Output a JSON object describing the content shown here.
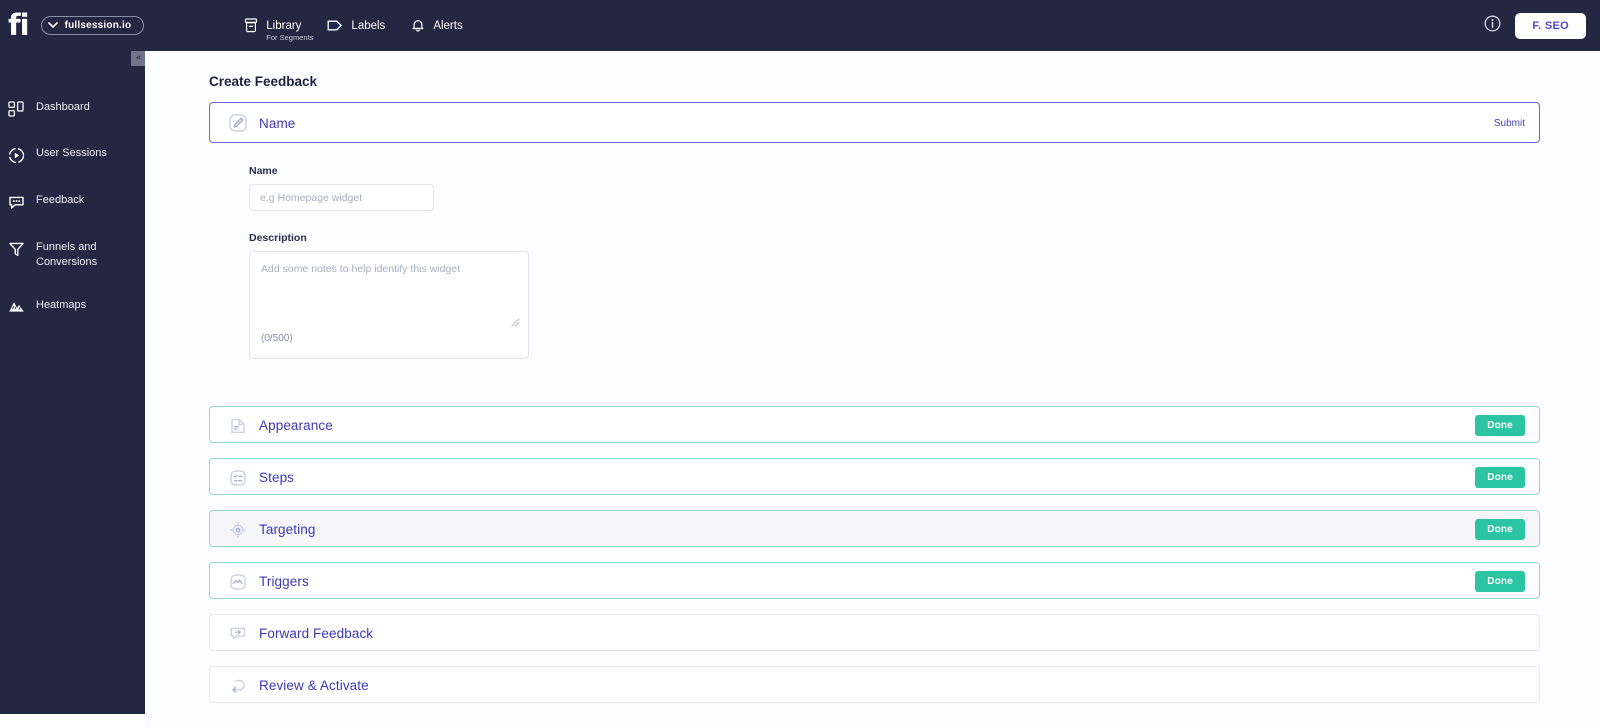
{
  "brand": {
    "logo_text": "fi",
    "accent_indigo": "#3b39b8",
    "accent_teal": "#2cc5a4",
    "header_navy": "#232742"
  },
  "topbar": {
    "site_selector": {
      "value": "fullsession.io",
      "chevron_icon": "chevron-down-icon"
    },
    "nav": [
      {
        "label": "Library",
        "sublabel": "For Segments",
        "icon": "library-archive-icon"
      },
      {
        "label": "Labels",
        "sublabel": "",
        "icon": "tag-icon"
      },
      {
        "label": "Alerts",
        "sublabel": "",
        "icon": "bell-icon"
      }
    ],
    "info_icon": "info-circle-icon",
    "account_button": "F. SEO"
  },
  "sidebar": {
    "collapse_label": "«",
    "items": [
      {
        "label": "Dashboard",
        "icon": "dashboard-grid-icon"
      },
      {
        "label": "User Sessions",
        "icon": "play-circle-icon"
      },
      {
        "label": "Feedback",
        "icon": "chat-bubble-icon"
      },
      {
        "label": "Funnels and Conversions",
        "icon": "funnel-icon"
      },
      {
        "label": "Heatmaps",
        "icon": "heatmap-mountain-icon"
      }
    ]
  },
  "main": {
    "page_title": "Create Feedback",
    "name_section": {
      "title": "Name",
      "icon": "edit-pencil-square-icon",
      "submit_label": "Submit",
      "name_field": {
        "label": "Name",
        "value": "",
        "placeholder": "e.g Homepage widget"
      },
      "description_field": {
        "label": "Description",
        "value": "",
        "placeholder": "Add some notes to help identify this widget",
        "counter": "(0/500)",
        "resize_icon": "resize-grip-icon"
      }
    },
    "sections": [
      {
        "title": "Appearance",
        "icon": "document-lines-icon",
        "status": "Done",
        "state": "done"
      },
      {
        "title": "Steps",
        "icon": "checklist-icon",
        "status": "Done",
        "state": "done"
      },
      {
        "title": "Targeting",
        "icon": "crosshair-icon",
        "status": "Done",
        "state": "done-hover"
      },
      {
        "title": "Triggers",
        "icon": "activity-pulse-icon",
        "status": "Done",
        "state": "done"
      },
      {
        "title": "Forward Feedback",
        "icon": "forward-chat-icon",
        "status": "",
        "state": "plain"
      },
      {
        "title": "Review & Activate",
        "icon": "arrow-left-back-icon",
        "status": "",
        "state": "plain"
      }
    ]
  }
}
